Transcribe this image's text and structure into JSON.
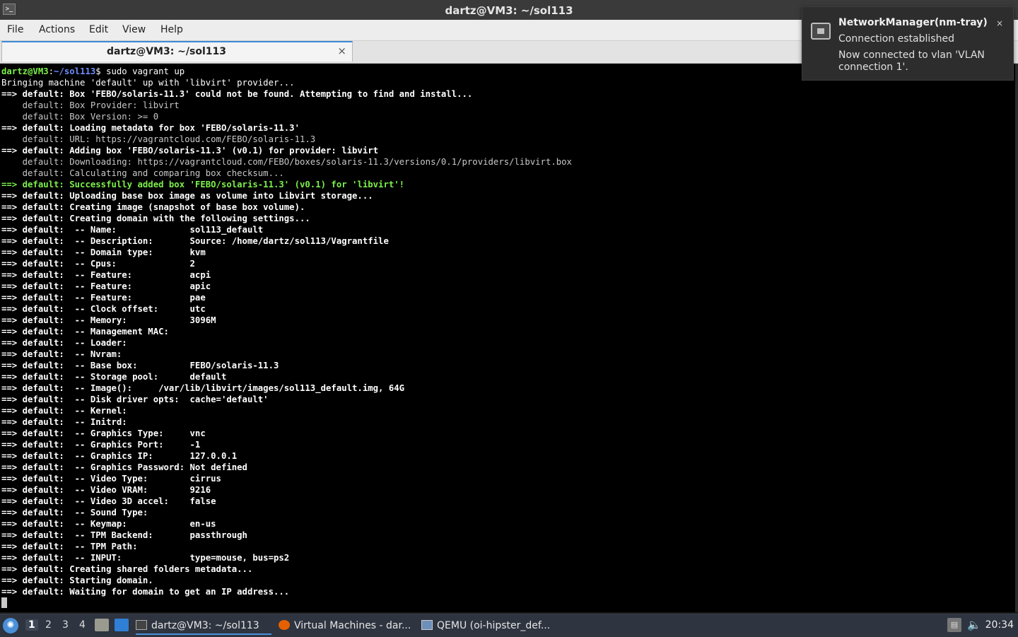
{
  "window": {
    "title": "dartz@VM3: ~/sol113",
    "app_icon": "terminal-icon"
  },
  "menubar": {
    "items": [
      "File",
      "Actions",
      "Edit",
      "View",
      "Help"
    ]
  },
  "tab": {
    "label": "dartz@VM3: ~/sol113",
    "close": "×"
  },
  "terminal": {
    "prompt_user": "dartz@VM3",
    "prompt_path": "~/sol113",
    "command": "sudo vagrant up",
    "lines": [
      {
        "kind": "plain",
        "text": "Bringing machine 'default' up with 'libvirt' provider..."
      },
      {
        "kind": "bold",
        "text": "==> default: Box 'FEBO/solaris-11.3' could not be found. Attempting to find and install..."
      },
      {
        "kind": "dim",
        "text": "    default: Box Provider: libvirt"
      },
      {
        "kind": "dim",
        "text": "    default: Box Version: >= 0"
      },
      {
        "kind": "bold",
        "text": "==> default: Loading metadata for box 'FEBO/solaris-11.3'"
      },
      {
        "kind": "dim",
        "text": "    default: URL: https://vagrantcloud.com/FEBO/solaris-11.3"
      },
      {
        "kind": "bold",
        "text": "==> default: Adding box 'FEBO/solaris-11.3' (v0.1) for provider: libvirt"
      },
      {
        "kind": "dim",
        "text": "    default: Downloading: https://vagrantcloud.com/FEBO/boxes/solaris-11.3/versions/0.1/providers/libvirt.box"
      },
      {
        "kind": "dim",
        "text": "    default: Calculating and comparing box checksum..."
      },
      {
        "kind": "green",
        "text": "==> default: Successfully added box 'FEBO/solaris-11.3' (v0.1) for 'libvirt'!"
      },
      {
        "kind": "bold",
        "text": "==> default: Uploading base box image as volume into Libvirt storage..."
      },
      {
        "kind": "bold",
        "text": "==> default: Creating image (snapshot of base box volume)."
      },
      {
        "kind": "bold",
        "text": "==> default: Creating domain with the following settings..."
      },
      {
        "kind": "bold",
        "text": "==> default:  -- Name:              sol113_default"
      },
      {
        "kind": "bold",
        "text": "==> default:  -- Description:       Source: /home/dartz/sol113/Vagrantfile"
      },
      {
        "kind": "bold",
        "text": "==> default:  -- Domain type:       kvm"
      },
      {
        "kind": "bold",
        "text": "==> default:  -- Cpus:              2"
      },
      {
        "kind": "bold",
        "text": "==> default:  -- Feature:           acpi"
      },
      {
        "kind": "bold",
        "text": "==> default:  -- Feature:           apic"
      },
      {
        "kind": "bold",
        "text": "==> default:  -- Feature:           pae"
      },
      {
        "kind": "bold",
        "text": "==> default:  -- Clock offset:      utc"
      },
      {
        "kind": "bold",
        "text": "==> default:  -- Memory:            3096M"
      },
      {
        "kind": "bold",
        "text": "==> default:  -- Management MAC:"
      },
      {
        "kind": "bold",
        "text": "==> default:  -- Loader:"
      },
      {
        "kind": "bold",
        "text": "==> default:  -- Nvram:"
      },
      {
        "kind": "bold",
        "text": "==> default:  -- Base box:          FEBO/solaris-11.3"
      },
      {
        "kind": "bold",
        "text": "==> default:  -- Storage pool:      default"
      },
      {
        "kind": "bold",
        "text": "==> default:  -- Image():     /var/lib/libvirt/images/sol113_default.img, 64G"
      },
      {
        "kind": "bold",
        "text": "==> default:  -- Disk driver opts:  cache='default'"
      },
      {
        "kind": "bold",
        "text": "==> default:  -- Kernel:"
      },
      {
        "kind": "bold",
        "text": "==> default:  -- Initrd:"
      },
      {
        "kind": "bold",
        "text": "==> default:  -- Graphics Type:     vnc"
      },
      {
        "kind": "bold",
        "text": "==> default:  -- Graphics Port:     -1"
      },
      {
        "kind": "bold",
        "text": "==> default:  -- Graphics IP:       127.0.0.1"
      },
      {
        "kind": "bold",
        "text": "==> default:  -- Graphics Password: Not defined"
      },
      {
        "kind": "bold",
        "text": "==> default:  -- Video Type:        cirrus"
      },
      {
        "kind": "bold",
        "text": "==> default:  -- Video VRAM:        9216"
      },
      {
        "kind": "bold",
        "text": "==> default:  -- Video 3D accel:    false"
      },
      {
        "kind": "bold",
        "text": "==> default:  -- Sound Type:"
      },
      {
        "kind": "bold",
        "text": "==> default:  -- Keymap:            en-us"
      },
      {
        "kind": "bold",
        "text": "==> default:  -- TPM Backend:       passthrough"
      },
      {
        "kind": "bold",
        "text": "==> default:  -- TPM Path:"
      },
      {
        "kind": "bold",
        "text": "==> default:  -- INPUT:             type=mouse, bus=ps2"
      },
      {
        "kind": "bold",
        "text": "==> default: Creating shared folders metadata..."
      },
      {
        "kind": "bold",
        "text": "==> default: Starting domain."
      },
      {
        "kind": "bold",
        "text": "==> default: Waiting for domain to get an IP address..."
      }
    ]
  },
  "notification": {
    "icon": "network-icon",
    "title": "NetworkManager(nm-tray)",
    "subtitle": "Connection established",
    "body": "Now connected to vlan 'VLAN connection 1'.",
    "close": "×"
  },
  "taskbar": {
    "start_icon": "start-menu-icon",
    "workspaces": [
      "1",
      "2",
      "3",
      "4"
    ],
    "active_workspace": "1",
    "tasks": [
      {
        "label": "dartz@VM3: ~/sol113",
        "icon": "terminal-icon"
      },
      {
        "label": "Virtual Machines - dar...",
        "icon": "firefox-icon"
      },
      {
        "label": "QEMU (oi-hipster_def...",
        "icon": "monitor-icon"
      }
    ],
    "clock": "20:34"
  },
  "colors": {
    "accent": "#3c8bd9",
    "terminal_bg": "#000000",
    "prompt_green": "#7cf04a",
    "prompt_blue": "#6f8cff"
  }
}
